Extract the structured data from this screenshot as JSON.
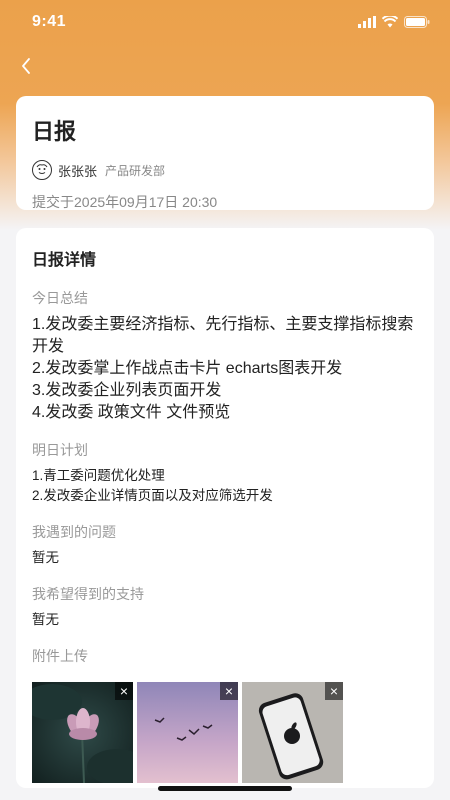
{
  "status_bar": {
    "time": "9:41"
  },
  "header": {
    "title": "日报",
    "author": "张张张",
    "department": "产品研发部",
    "submitted": "提交于2025年09月17日   20:30"
  },
  "detail": {
    "section_title": "日报详情",
    "today_label": "今日总结",
    "today_items": [
      "1.发改委主要经济指标、先行指标、主要支撑指标搜索开发",
      "2.发改委掌上作战点击卡片 echarts图表开发",
      "3.发改委企业列表页面开发",
      "4.发改委 政策文件 文件预览"
    ],
    "tomorrow_label": "明日计划",
    "tomorrow_items": [
      "1.青工委问题优化处理",
      "2.发改委企业详情页面以及对应筛选开发"
    ],
    "problems_label": "我遇到的问题",
    "problems_value": "暂无",
    "support_label": "我希望得到的支持",
    "support_value": "暂无",
    "attachments_label": "附件上传",
    "attachments": [
      {
        "name": "lotus-photo"
      },
      {
        "name": "birds-photo"
      },
      {
        "name": "phone-photo"
      }
    ],
    "remove_glyph": "×"
  },
  "colors": {
    "header_orange": "#eba14b",
    "card_bg": "#ffffff",
    "page_bg": "#f4f4f6"
  }
}
